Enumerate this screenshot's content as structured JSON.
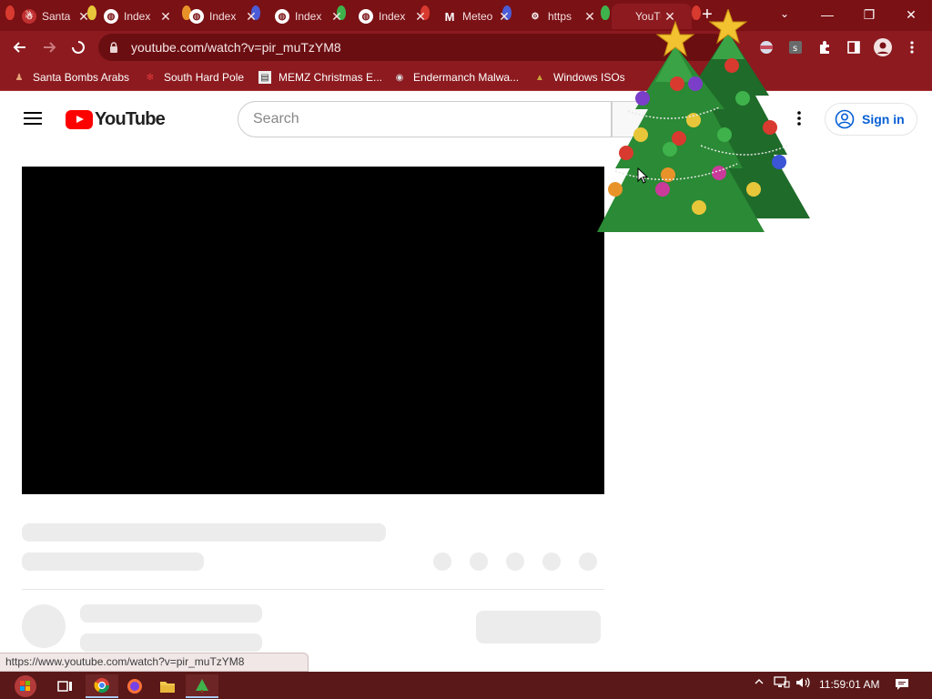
{
  "browser": {
    "tabs": [
      {
        "label": "Santa",
        "favicon": "santa-icon",
        "color": "#cc2b2b"
      },
      {
        "label": "Index",
        "favicon": "globe-icon",
        "color": "#ffffff"
      },
      {
        "label": "Index",
        "favicon": "globe-icon",
        "color": "#ffffff"
      },
      {
        "label": "Index",
        "favicon": "globe-icon",
        "color": "#ffffff"
      },
      {
        "label": "Index",
        "favicon": "globe-icon",
        "color": "#ffffff"
      },
      {
        "label": "Meteo",
        "favicon": "m-logo-icon",
        "color": "#ffffff"
      },
      {
        "label": "https",
        "favicon": "eagle-icon",
        "color": "#ffffff"
      },
      {
        "label": "YouTube",
        "favicon": "youtube-icon",
        "color": "#ff0000"
      }
    ],
    "new_tab_symbol": "+",
    "tab_search_symbol": "⌄",
    "window_controls": {
      "minimize": "—",
      "restore": "❐",
      "close": "✕"
    },
    "url": "youtube.com/watch?v=pir_muTzYM8",
    "bookmarks": [
      {
        "label": "Santa Bombs Arabs",
        "icon": "santa-icon"
      },
      {
        "label": "South Hard Pole",
        "icon": "snowflake-icon"
      },
      {
        "label": "MEMZ Christmas E...",
        "icon": "memz-icon"
      },
      {
        "label": "Endermanch Malwa...",
        "icon": "raccoon-icon"
      },
      {
        "label": "Windows ISOs",
        "icon": "pine-icon"
      }
    ],
    "status_url": "https://www.youtube.com/watch?v=pir_muTzYM8"
  },
  "youtube": {
    "logo_text": "YouTube",
    "search_placeholder": "Search",
    "sign_in_label": "Sign in"
  },
  "taskbar": {
    "clock": "11:59:01 AM",
    "items": [
      "start-orb-icon",
      "task-view-icon",
      "chrome-icon",
      "firefox-icon",
      "file-explorer-icon",
      "app-icon"
    ]
  },
  "colors": {
    "tabstrip": "#7a1115",
    "toolbar": "#8c1a1f",
    "youtube_red": "#ff0000",
    "link_blue": "#065fd4"
  }
}
